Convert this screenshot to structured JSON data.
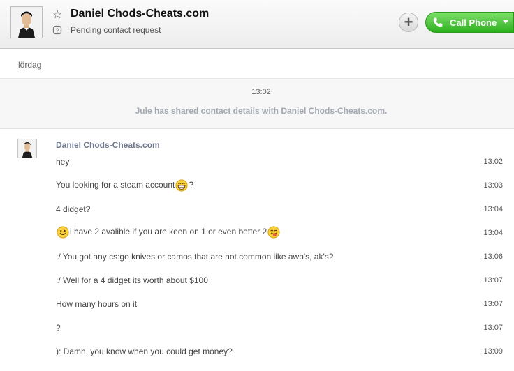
{
  "header": {
    "contact_name": "Daniel Chods-Cheats.com",
    "status": "Pending contact request",
    "star_icon": "star-icon",
    "add_label": "+",
    "call_label": "Call Phone"
  },
  "conversation": {
    "day_label": "lördag",
    "system_time": "13:02",
    "system_message": "Jule has shared contact details with Daniel Chods-Cheats.com.",
    "sender": "Daniel Chods-Cheats.com",
    "messages": [
      {
        "pre": "hey",
        "post": "",
        "time": "13:02"
      },
      {
        "pre": "You looking for a steam account",
        "post": "?",
        "time": "13:03"
      },
      {
        "pre": "4 didget?",
        "post": "",
        "time": "13:04"
      },
      {
        "pre": "i have 2 avalible if you are keen on 1 or even better 2",
        "post": "",
        "time": "13:04"
      },
      {
        "pre": ":/ You got any cs:go knives or camos that are not common like awp's, ak's?",
        "post": "",
        "time": "13:06"
      },
      {
        "pre": ":/ Well for a 4 didget its worth about $100",
        "post": "",
        "time": "13:07"
      },
      {
        "pre": "How many hours on it",
        "post": "",
        "time": "13:07"
      },
      {
        "pre": "?",
        "post": "",
        "time": "13:07"
      },
      {
        "pre": "): Damn, you know when you could get money?",
        "post": "",
        "time": "13:09"
      }
    ]
  },
  "colors": {
    "call_green": "#2fae20",
    "sender_name": "#707a8f",
    "system_text": "#a3a8b2"
  }
}
